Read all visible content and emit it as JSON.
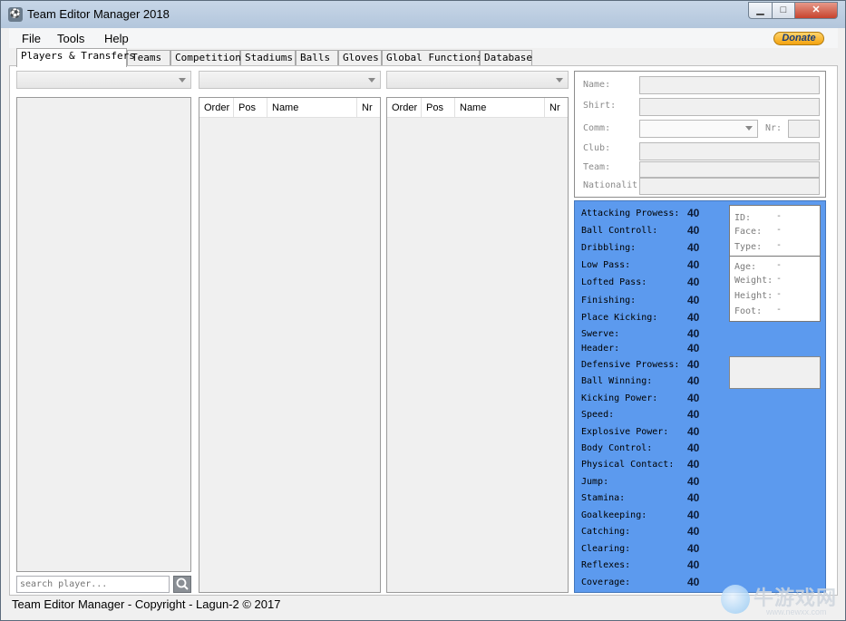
{
  "window": {
    "title": "Team Editor Manager 2018",
    "minimize": "▁",
    "maximize": "□",
    "close": "✕",
    "app_icon": "app-icon"
  },
  "menu": [
    "File",
    "Tools",
    "Help"
  ],
  "donate_label": "Donate",
  "tabs": [
    "Players & Transfers",
    "Teams",
    "Competition",
    "Stadiums",
    "Balls",
    "Gloves",
    "Global Functions",
    "Database"
  ],
  "grid_columns": {
    "order": "Order",
    "pos": "Pos",
    "name": "Name",
    "nr": "Nr"
  },
  "search": {
    "placeholder": "search player...",
    "icon": "search-icon"
  },
  "player_info": {
    "name": "Name:",
    "shirt": "Shirt:",
    "comm": "Comm:",
    "nr": "Nr:",
    "club": "Club:",
    "team": "Team:",
    "nationality": "Nationalit"
  },
  "stats": [
    {
      "label": "Attacking Prowess:",
      "value": "40"
    },
    {
      "label": "Ball Controll:",
      "value": "40"
    },
    {
      "label": "Dribbling:",
      "value": "40"
    },
    {
      "label": "Low Pass:",
      "value": "40"
    },
    {
      "label": "Lofted Pass:",
      "value": "40"
    },
    {
      "label": "Finishing:",
      "value": "40"
    },
    {
      "label": "Place Kicking:",
      "value": "40"
    },
    {
      "label": "Swerve:",
      "value": "40"
    },
    {
      "label": "Header:",
      "value": "40"
    },
    {
      "label": "Defensive Prowess:",
      "value": "40"
    },
    {
      "label": "Ball Winning:",
      "value": "40"
    },
    {
      "label": "Kicking Power:",
      "value": "40"
    },
    {
      "label": "Speed:",
      "value": "40"
    },
    {
      "label": "Explosive Power:",
      "value": "40"
    },
    {
      "label": "Body Control:",
      "value": "40"
    },
    {
      "label": "Physical Contact:",
      "value": "40"
    },
    {
      "label": "Jump:",
      "value": "40"
    },
    {
      "label": "Stamina:",
      "value": "40"
    },
    {
      "label": "Goalkeeping:",
      "value": "40"
    },
    {
      "label": "Catching:",
      "value": "40"
    },
    {
      "label": "Clearing:",
      "value": "40"
    },
    {
      "label": "Reflexes:",
      "value": "40"
    },
    {
      "label": "Coverage:",
      "value": "40"
    }
  ],
  "id_card": [
    {
      "label": "ID:",
      "value": "-"
    },
    {
      "label": "Face:",
      "value": "-"
    },
    {
      "label": "Type:",
      "value": "-"
    },
    {
      "label": "Age:",
      "value": "-"
    },
    {
      "label": "Weight:",
      "value": "-"
    },
    {
      "label": "Height:",
      "value": "-"
    },
    {
      "label": "Foot:",
      "value": "-"
    }
  ],
  "status_text": "Team Editor Manager - Copyright - Lagun-2 © 2017",
  "watermark": {
    "text": "牛游戏网",
    "sub": "www.newxx.com"
  },
  "colors": {
    "stats_panel": "#5c9aee",
    "donate": "#f3a310",
    "close": "#c7432e"
  }
}
